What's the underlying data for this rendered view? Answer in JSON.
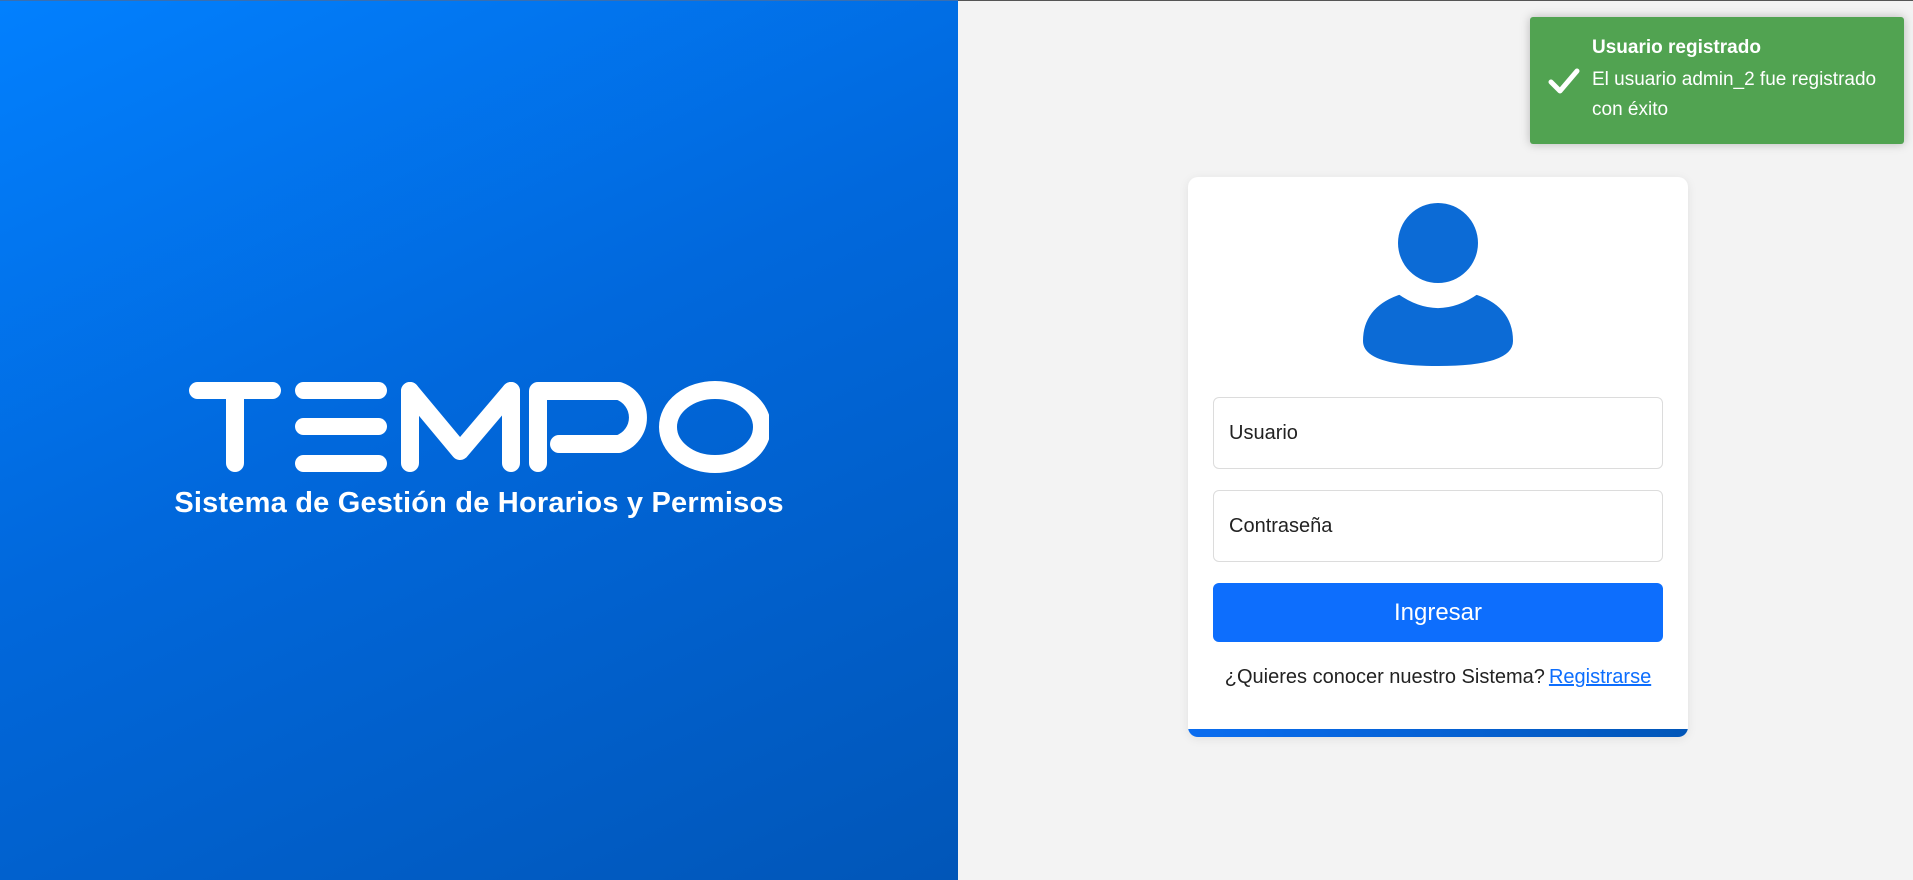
{
  "brand": {
    "logo_text": "TEMPO",
    "tagline": "Sistema de Gestión de Horarios y Permisos",
    "primary_color": "#0168dc"
  },
  "login": {
    "avatar_icon": "user-icon",
    "username_placeholder": "Usuario",
    "password_placeholder": "Contraseña",
    "submit_label": "Ingresar",
    "register_prompt": "¿Quieres conocer nuestro Sistema?",
    "register_link": "Registrarse",
    "button_color": "#0d6efd"
  },
  "toast": {
    "icon": "check-icon",
    "title": "Usuario registrado",
    "message": "El usuario admin_2 fue registrado con éxito",
    "color": "#51a351"
  }
}
